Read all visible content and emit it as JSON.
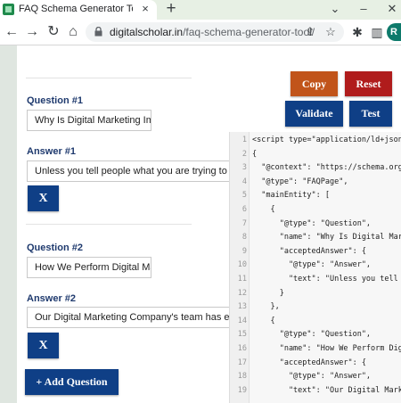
{
  "browser": {
    "tab_title": "FAQ Schema Generator Tool - FA",
    "tab_close": "×",
    "new_tab": "+",
    "win_minimize": "–",
    "win_close": "✕",
    "url_domain": "digitalscholar.in",
    "url_path": "/faq-schema-generator-tool/",
    "profile_initial": "R"
  },
  "buttons": {
    "copy": "Copy",
    "reset": "Reset",
    "validate": "Validate",
    "test": "Test",
    "remove": "X",
    "add_question": "+ Add Question"
  },
  "faq": [
    {
      "question_label": "Question #1",
      "question_value": "Why Is Digital Marketing Imp",
      "answer_label": "Answer #1",
      "answer_value": "Unless you tell people what you are trying to sell, it"
    },
    {
      "question_label": "Question #2",
      "question_value": "How We Perform Digital Mar",
      "answer_label": "Answer #2",
      "answer_value": "Our Digital Marketing Company's team has experie"
    }
  ],
  "code": {
    "lines": [
      {
        "n": "1",
        "text": "<script type=\"application/ld+json"
      },
      {
        "n": "2",
        "text": "{"
      },
      {
        "n": "3",
        "text": "  \"@context\": \"https://schema.org"
      },
      {
        "n": "4",
        "text": "  \"@type\": \"FAQPage\","
      },
      {
        "n": "5",
        "text": "  \"mainEntity\": ["
      },
      {
        "n": "6",
        "text": "    {"
      },
      {
        "n": "7",
        "text": "      \"@type\": \"Question\","
      },
      {
        "n": "8",
        "text": "      \"name\": \"Why Is Digital Mark"
      },
      {
        "n": "9",
        "text": "      \"acceptedAnswer\": {"
      },
      {
        "n": "10",
        "text": "        \"@type\": \"Answer\","
      },
      {
        "n": "11",
        "text": "        \"text\": \"Unless you tell p"
      },
      {
        "n": "12",
        "text": "      }"
      },
      {
        "n": "13",
        "text": "    },"
      },
      {
        "n": "14",
        "text": "    {"
      },
      {
        "n": "15",
        "text": "      \"@type\": \"Question\","
      },
      {
        "n": "16",
        "text": "      \"name\": \"How We Perform Dig"
      },
      {
        "n": "17",
        "text": "      \"acceptedAnswer\": {"
      },
      {
        "n": "18",
        "text": "        \"@type\": \"Answer\","
      },
      {
        "n": "19",
        "text": "        \"text\": \"Our Digital Marke"
      }
    ]
  },
  "colors": {
    "copy": "#c1541a",
    "reset": "#b01c1c",
    "primary": "#0f3f86",
    "label": "#1f3a6e"
  }
}
